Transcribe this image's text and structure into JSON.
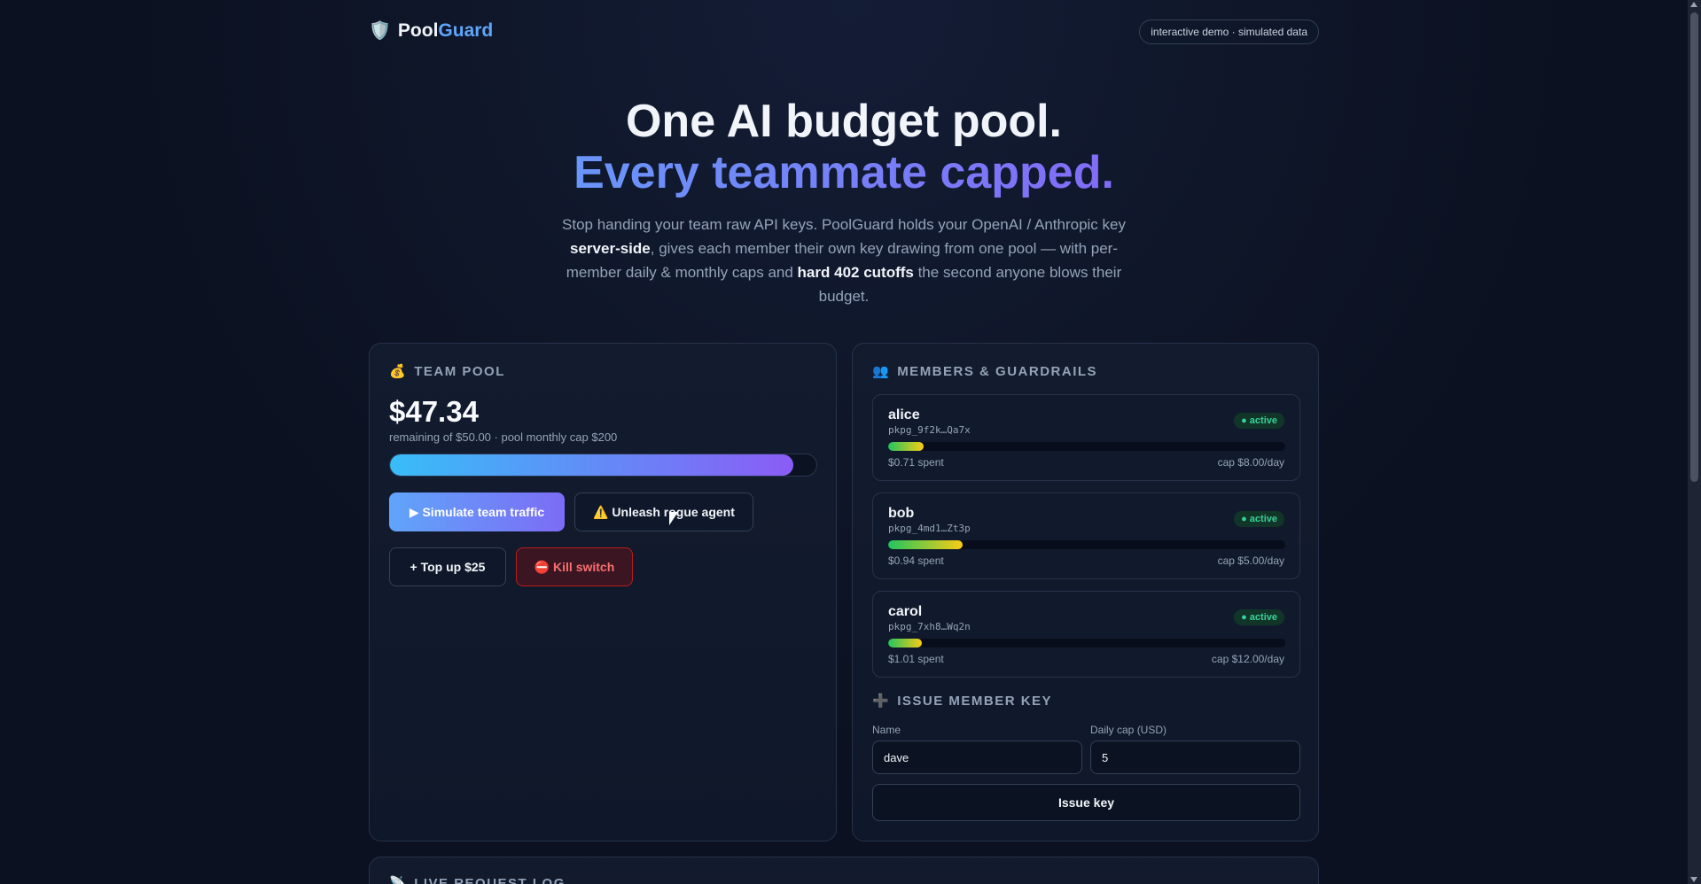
{
  "header": {
    "brand_pool": "Pool",
    "brand_guard": "Guard",
    "brand_icon": "shield-icon",
    "demo_pill": "interactive demo · simulated data"
  },
  "hero": {
    "title_line1": "One AI budget pool.",
    "title_line2": "Every teammate capped.",
    "lead_1": "Stop handing your team raw API keys. PoolGuard holds your OpenAI / Anthropic key ",
    "lead_bold1": "server-side",
    "lead_2": ", gives each member their own key drawing from one pool — with per-member daily & monthly caps and ",
    "lead_bold2": "hard 402 cutoffs",
    "lead_3": " the second anyone blows their budget."
  },
  "pool": {
    "title": "TEAM POOL",
    "icon": "money-bag-icon",
    "amount": "$47.34",
    "subtitle": "remaining of $50.00 · pool monthly cap $200",
    "remaining_fraction": 0.9468,
    "buttons": {
      "simulate": "▶ Simulate team traffic",
      "rogue": "⚠️ Unleash rogue agent",
      "topup": "+ Top up $25",
      "kill": "⛔ Kill switch"
    }
  },
  "members": {
    "title": "MEMBERS & GUARDRAILS",
    "icon": "people-icon",
    "items": [
      {
        "name": "alice",
        "key": "pkpg_9f2k…Qa7x",
        "status": "● active",
        "spent": "$0.71 spent",
        "cap": "cap $8.00/day",
        "fraction": 0.089
      },
      {
        "name": "bob",
        "key": "pkpg_4md1…Zt3p",
        "status": "● active",
        "spent": "$0.94 spent",
        "cap": "cap $5.00/day",
        "fraction": 0.188
      },
      {
        "name": "carol",
        "key": "pkpg_7xh8…Wq2n",
        "status": "● active",
        "spent": "$1.01 spent",
        "cap": "cap $12.00/day",
        "fraction": 0.084
      }
    ]
  },
  "issue": {
    "title": "ISSUE MEMBER KEY",
    "icon": "plus-icon",
    "name_label": "Name",
    "name_value": "dave",
    "cap_label": "Daily cap (USD)",
    "cap_value": "5",
    "button": "Issue key"
  },
  "log": {
    "title": "LIVE REQUEST LOG",
    "icon": "satellite-icon"
  },
  "colors": {
    "accent_blue": "#60a5fa",
    "accent_purple": "#8b5cf6",
    "active_green": "#34d399",
    "danger_red": "#f87171"
  }
}
